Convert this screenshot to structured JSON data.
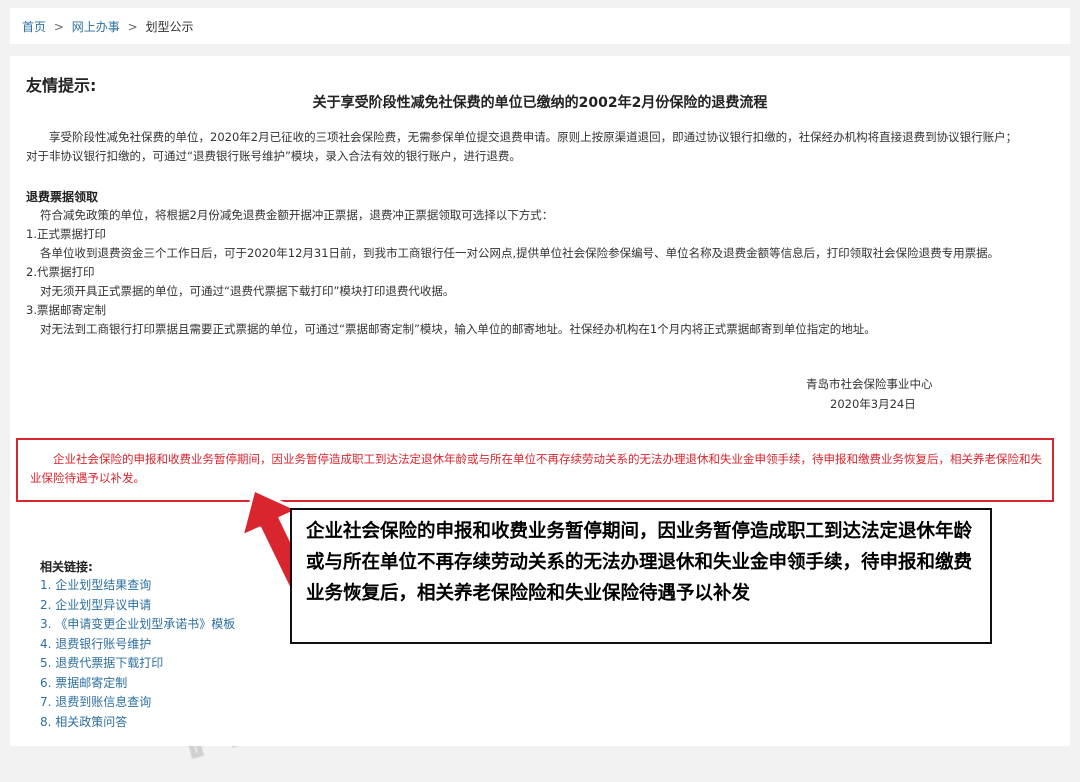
{
  "breadcrumb": {
    "home": "首页",
    "sep": ">",
    "online": "网上办事",
    "current": "划型公示"
  },
  "tip_title": "友情提示:",
  "doc_title": "关于享受阶段性减免社保费的单位已缴纳的2002年2月份保险的退费流程",
  "intro": [
    "享受阶段性减免社保费的单位，2020年2月已征收的三项社会保险费，无需参保单位提交退费申请。原则上按原渠道退回，即通过协议银行扣缴的，社保经办机构将直接退费到协议银行账户；",
    "对于非协议银行扣缴的，可通过“退费银行账号维护”模块，录入合法有效的银行账户，进行退费。"
  ],
  "section": {
    "heading": "退费票据领取",
    "lines": [
      "符合减免政策的单位，将根据2月份减免退费金额开据冲正票据，退费冲正票据领取可选择以下方式：",
      "1.正式票据打印",
      "各单位收到退费资金三个工作日后，可于2020年12月31日前，到我市工商银行任一对公网点,提供单位社会保险参保编号、单位名称及退费金额等信息后，打印领取社会保险退费专用票据。",
      "2.代票据打印",
      "对无须开具正式票据的单位，可通过“退费代票据下载打印”模块打印退费代收据。",
      "3.票据邮寄定制",
      "对无法到工商银行打印票据且需要正式票据的单位，可通过“票据邮寄定制”模块，输入单位的邮寄地址。社保经办机构在1个月内将正式票据邮寄到单位指定的地址。"
    ]
  },
  "signature": {
    "org": "青岛市社会保险事业中心",
    "date": "2020年3月24日"
  },
  "notice": "企业社会保险的申报和收费业务暂停期间，因业务暂停造成职工到达法定退休年龄或与所在单位不再存续劳动关系的无法办理退休和失业金申领手续，待申报和缴费业务恢复后，相关养老保险和失业保险待遇予以补发。",
  "related": {
    "title": "相关链接:",
    "links": [
      "1. 企业划型结果查询",
      "2. 企业划型异议申请",
      "3. 《申请变更企业划型承诺书》模板",
      "4. 退费银行账号维护",
      "5. 退费代票据下载打印",
      "6. 票据邮寄定制",
      "7. 退费到账信息查询",
      "8. 相关政策问答"
    ]
  },
  "callout": "企业社会保险的申报和收费业务暂停期间，因业务暂停造成职工到达法定退休年龄或与所在单位不再存续劳动关系的无法办理退休和失业金申领手续，待申报和缴费业务恢复后，相关养老保险险和失业保险待遇予以补发",
  "watermark": "青岛12333",
  "colors": {
    "link": "#2e6fa0",
    "notice_red": "#d9252e",
    "arrow_red": "#d9252e"
  }
}
